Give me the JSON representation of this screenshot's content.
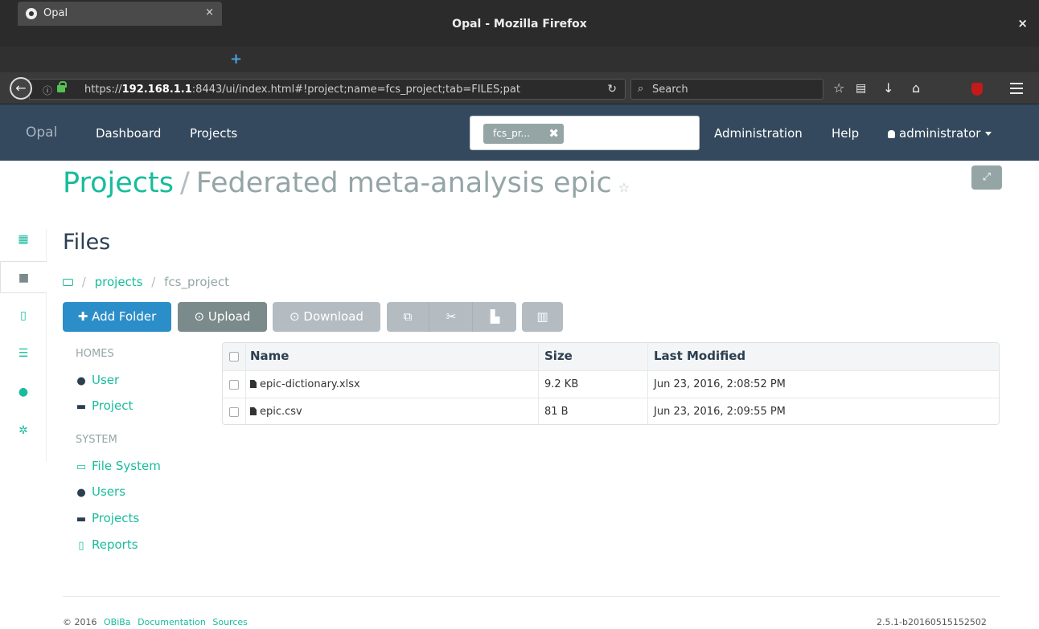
{
  "window": {
    "title": "Opal - Mozilla Firefox",
    "close_glyph": "×"
  },
  "browser": {
    "tab_label": "Opal",
    "tab_close": "×",
    "new_tab": "+",
    "url_prefix": "https://",
    "url_host": "192.168.1.1",
    "url_rest": ":8443/ui/index.html#!project;name=fcs_project;tab=FILES;pat",
    "search_placeholder": "Search"
  },
  "appnav": {
    "brand": "Opal",
    "dashboard": "Dashboard",
    "projects": "Projects",
    "search_chip": "fcs_pr...",
    "search_chip_close": "✖",
    "administration": "Administration",
    "help": "Help",
    "user": "administrator"
  },
  "header": {
    "projects": "Projects",
    "separator": "/",
    "project_title": "Federated meta-analysis epic",
    "star": "☆",
    "expand": "⤢"
  },
  "section": {
    "title": "Files",
    "breadcrumb_sep": "/",
    "breadcrumb_projects": "projects",
    "breadcrumb_current": "fcs_project"
  },
  "toolbar": {
    "add_folder": "Add Folder",
    "upload": "Upload",
    "download": "Download"
  },
  "file_nav": {
    "homes_heading": "HOMES",
    "user": "User",
    "project": "Project",
    "system_heading": "SYSTEM",
    "file_system": "File System",
    "users": "Users",
    "projects": "Projects",
    "reports": "Reports"
  },
  "table": {
    "columns": [
      "Name",
      "Size",
      "Last Modified"
    ],
    "rows": [
      {
        "name": "epic-dictionary.xlsx",
        "size": "9.2 KB",
        "modified": "Jun 23, 2016, 2:08:52 PM"
      },
      {
        "name": "epic.csv",
        "size": "81 B",
        "modified": "Jun 23, 2016, 2:09:55 PM"
      }
    ]
  },
  "footer": {
    "copyright": "© 2016",
    "obiba": "OBiBa",
    "documentation": "Documentation",
    "sources": "Sources",
    "version": "2.5.1-b20160515152502"
  },
  "colors": {
    "accent": "#18bc9c",
    "navbar": "#34495e",
    "primary_button": "#2c8ec8"
  }
}
